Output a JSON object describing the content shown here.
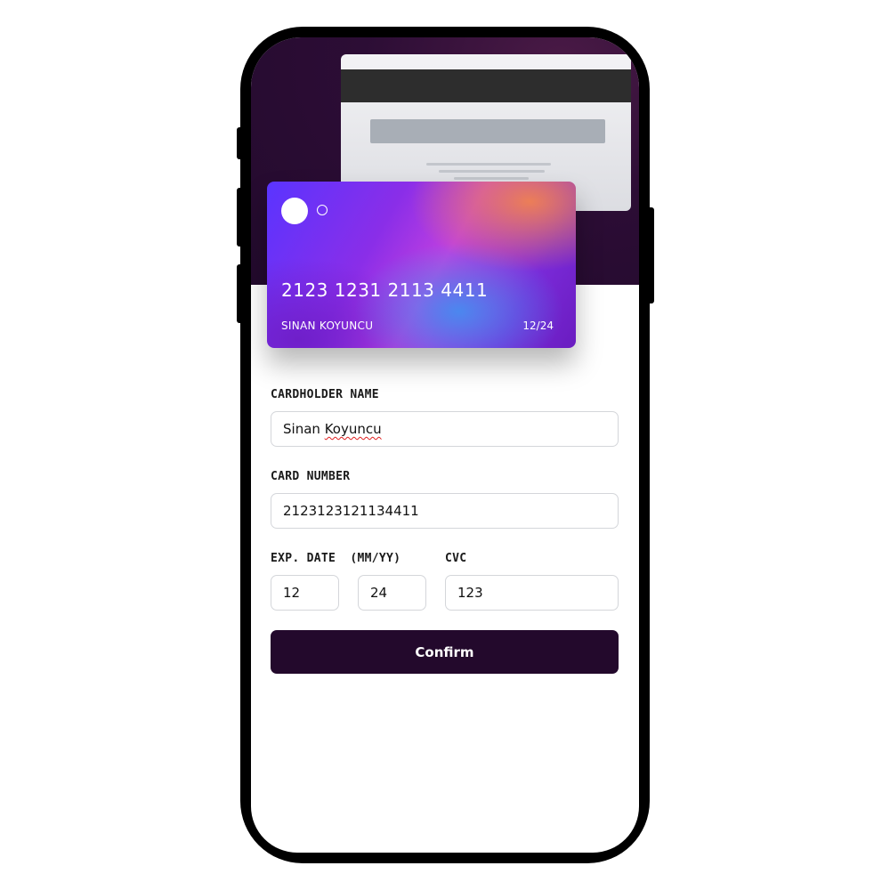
{
  "card": {
    "number": "2123 1231 2113 4411",
    "holder": "SINAN KOYUNCU",
    "expiry": "12/24"
  },
  "form": {
    "cardholder_label": "CARDHOLDER NAME",
    "cardholder_first": "Sinan",
    "cardholder_last": "Koyuncu",
    "card_number_label": "CARD NUMBER",
    "card_number_value": "2123123121134411",
    "exp_label": "EXP. DATE  (MM/YY)",
    "exp_month": "12",
    "exp_year": "24",
    "cvc_label": "CVC",
    "cvc_value": "123",
    "confirm_label": "Confirm"
  },
  "colors": {
    "hero_bg": "#230a2d",
    "button_bg": "#23092c",
    "input_border": "#d4d6da"
  },
  "icons": {
    "card_logo": "mastercard-style-circles-icon"
  }
}
